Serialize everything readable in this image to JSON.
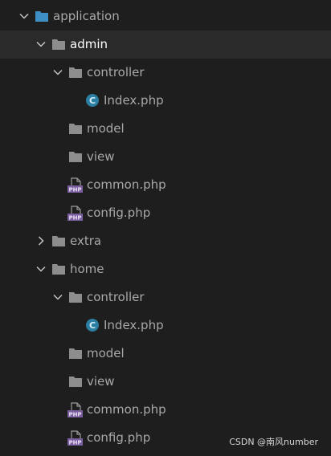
{
  "tree": {
    "items": [
      {
        "label": "application",
        "type": "folder",
        "expanded": true,
        "icon": "folder-icon",
        "depth": 0
      },
      {
        "label": "admin",
        "type": "folder",
        "expanded": true,
        "selected": true,
        "icon": "folder-icon",
        "depth": 1
      },
      {
        "label": "controller",
        "type": "folder",
        "expanded": true,
        "icon": "folder-icon",
        "depth": 2
      },
      {
        "label": "Index.php",
        "type": "class-file",
        "icon": "php-class-icon",
        "badge": "C",
        "depth": 3
      },
      {
        "label": "model",
        "type": "folder",
        "icon": "folder-icon",
        "depth": 2
      },
      {
        "label": "view",
        "type": "folder",
        "icon": "folder-icon",
        "depth": 2
      },
      {
        "label": "common.php",
        "type": "php-file",
        "icon": "php-file-icon",
        "badge": "PHP",
        "depth": 2
      },
      {
        "label": "config.php",
        "type": "php-file",
        "icon": "php-file-icon",
        "badge": "PHP",
        "depth": 2
      },
      {
        "label": "extra",
        "type": "folder",
        "expanded": false,
        "icon": "folder-icon",
        "depth": 1
      },
      {
        "label": "home",
        "type": "folder",
        "expanded": true,
        "icon": "folder-icon",
        "depth": 1
      },
      {
        "label": "controller",
        "type": "folder",
        "expanded": true,
        "icon": "folder-icon",
        "depth": 2
      },
      {
        "label": "Index.php",
        "type": "class-file",
        "icon": "php-class-icon",
        "badge": "C",
        "depth": 3
      },
      {
        "label": "model",
        "type": "folder",
        "icon": "folder-icon",
        "depth": 2
      },
      {
        "label": "view",
        "type": "folder",
        "icon": "folder-icon",
        "depth": 2
      },
      {
        "label": "common.php",
        "type": "php-file",
        "icon": "php-file-icon",
        "badge": "PHP",
        "depth": 2
      },
      {
        "label": "config.php",
        "type": "php-file",
        "icon": "php-file-icon",
        "badge": "PHP",
        "depth": 2
      }
    ]
  },
  "watermark": "CSDN @南风number",
  "colors": {
    "background": "#1e1e1e",
    "selected_row": "#2a2a2a",
    "root_folder": "#3d8fc4",
    "folder": "#8d8d8d",
    "class_badge": "#2b7fa3",
    "php_badge": "#7a5ea0",
    "text": "#a8a8a8"
  }
}
